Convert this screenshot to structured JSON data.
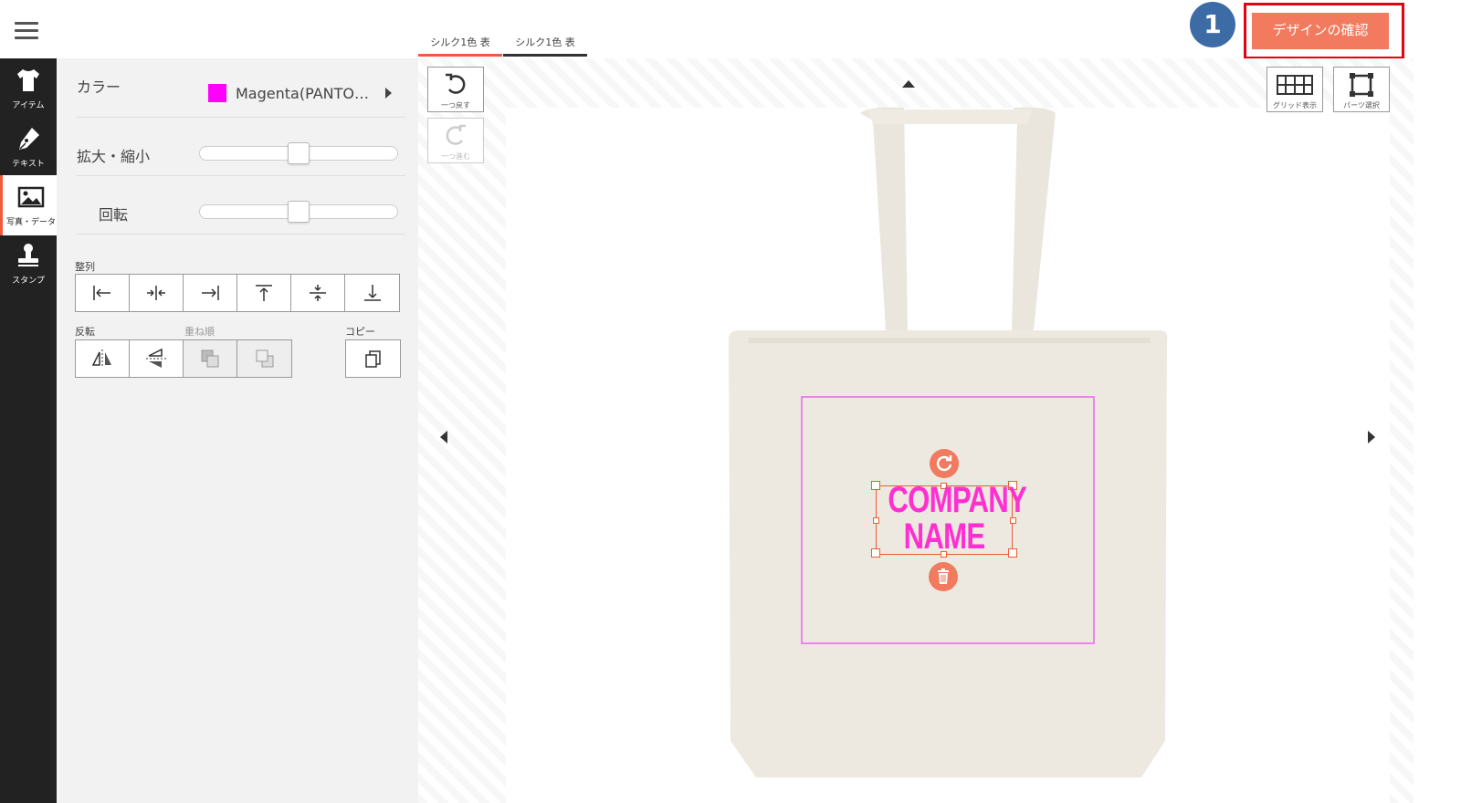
{
  "sidebar": {
    "items": [
      {
        "label": "アイテム",
        "icon": "tshirt-icon"
      },
      {
        "label": "テキスト",
        "icon": "pen-icon"
      },
      {
        "label": "写真・データ",
        "icon": "image-icon"
      },
      {
        "label": "スタンプ",
        "icon": "stamp-icon"
      }
    ]
  },
  "panel": {
    "color_label": "カラー",
    "color_value": "Magenta(PANTO…",
    "color_swatch": "#ff00ff",
    "scale_label": "拡大・縮小",
    "rotate_label": "回転",
    "align_label": "整列",
    "flip_label": "反転",
    "order_label": "重ね順",
    "copy_label": "コピー",
    "scale_value": 0.5,
    "rotate_value": 0.5
  },
  "tabs": [
    {
      "label": "シルク1色 表"
    },
    {
      "label": "シルク1色 表"
    }
  ],
  "toolbar": {
    "undo_label": "一つ戻す",
    "redo_label": "一つ進む",
    "grid_label": "グリッド表示",
    "parts_label": "パーツ選択"
  },
  "header": {
    "confirm_label": "デザインの確認",
    "step_number": "1",
    "accent": "#f27a5e",
    "highlight": "#e60012",
    "badge_color": "#3d6ba6"
  },
  "design": {
    "line1": "COMPANY",
    "line2": "NAME",
    "text_color": "#ff2fd0",
    "print_area_color": "#ee82ee"
  }
}
